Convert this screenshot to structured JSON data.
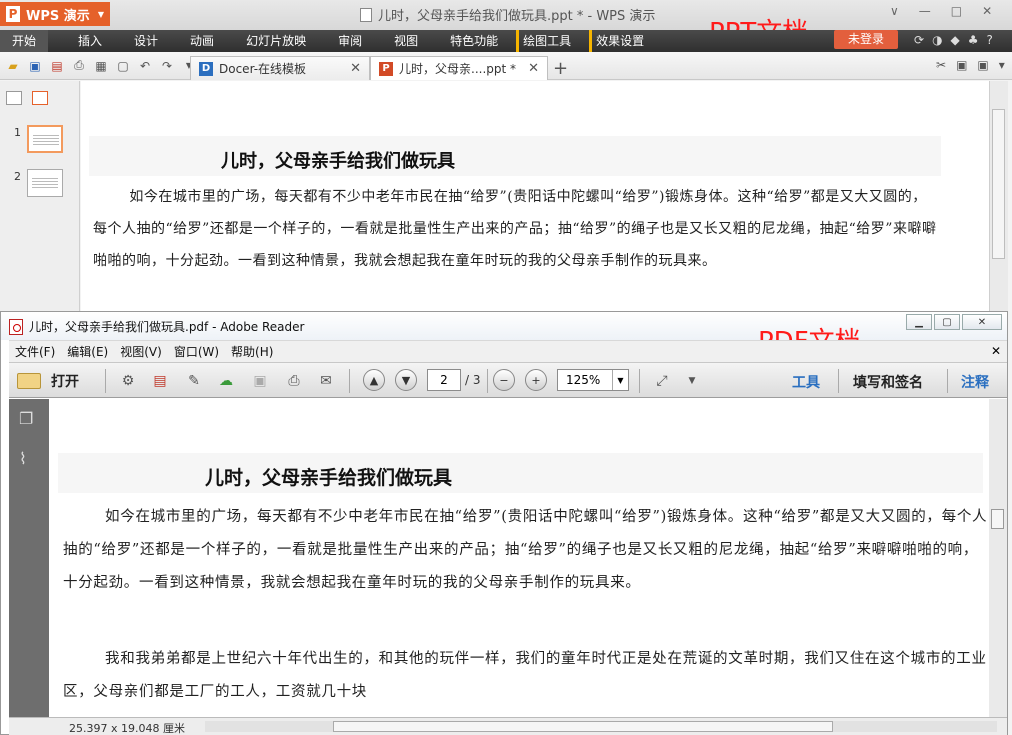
{
  "wps": {
    "app_button": "WPS 演示",
    "window_title": "儿时，父母亲手给我们做玩具.ppt * - WPS 演示",
    "annotation": "PPT文档",
    "menu": [
      "开始",
      "插入",
      "设计",
      "动画",
      "幻灯片放映",
      "审阅",
      "视图",
      "特色功能",
      "绘图工具",
      "效果设置"
    ],
    "login_button": "未登录",
    "tabs": [
      {
        "label": "Docer-在线模板"
      },
      {
        "label": "儿时，父母亲....ppt *"
      }
    ],
    "slide_numbers": [
      "1",
      "2"
    ],
    "slide_title": "儿时，父母亲手给我们做玩具",
    "slide_paragraph": "如今在城市里的广场，每天都有不少中老年市民在抽“给罗”(贵阳话中陀螺叫“给罗”)锻炼身体。这种“给罗”都是又大又圆的，每个人抽的“给罗”还都是一个样子的，一看就是批量性生产出来的产品；抽“给罗”的绳子也是又长又粗的尼龙绳，抽起“给罗”来噼噼啪啪的响，十分起劲。一看到这种情景，我就会想起我在童年时玩的我的父母亲手制作的玩具来。"
  },
  "reader": {
    "window_title": "儿时，父母亲手给我们做玩具.pdf - Adobe Reader",
    "annotation": "PDF文档",
    "menu": [
      "文件(F)",
      "编辑(E)",
      "视图(V)",
      "窗口(W)",
      "帮助(H)"
    ],
    "open_label": "打开",
    "page_current": "2",
    "page_total": "/ 3",
    "zoom": "125%",
    "right_buttons": [
      "工具",
      "填写和签名",
      "注释"
    ],
    "pdf_title": "儿时，父母亲手给我们做玩具",
    "pdf_paragraph1": "如今在城市里的广场，每天都有不少中老年市民在抽“给罗”(贵阳话中陀螺叫“给罗”)锻炼身体。这种“给罗”都是又大又圆的，每个人抽的“给罗”还都是一个样子的，一看就是批量性生产出来的产品；抽“给罗”的绳子也是又长又粗的尼龙绳，抽起“给罗”来噼噼啪啪的响，十分起劲。一看到这种情景，我就会想起我在童年时玩的我的父母亲手制作的玩具来。",
    "pdf_paragraph2": "我和我弟弟都是上世纪六十年代出生的，和其他的玩伴一样，我们的童年时代正是处在荒诞的文革时期，我们又住在这个城市的工业区，父母亲们都是工厂的工人，工资就几十块",
    "status_dims": "25.397 x 19.048 厘米"
  },
  "colors": {
    "wps_orange": "#e5612a",
    "annotation_red": "#ff1a1a",
    "menubar_dark": "#3a3a3a"
  }
}
